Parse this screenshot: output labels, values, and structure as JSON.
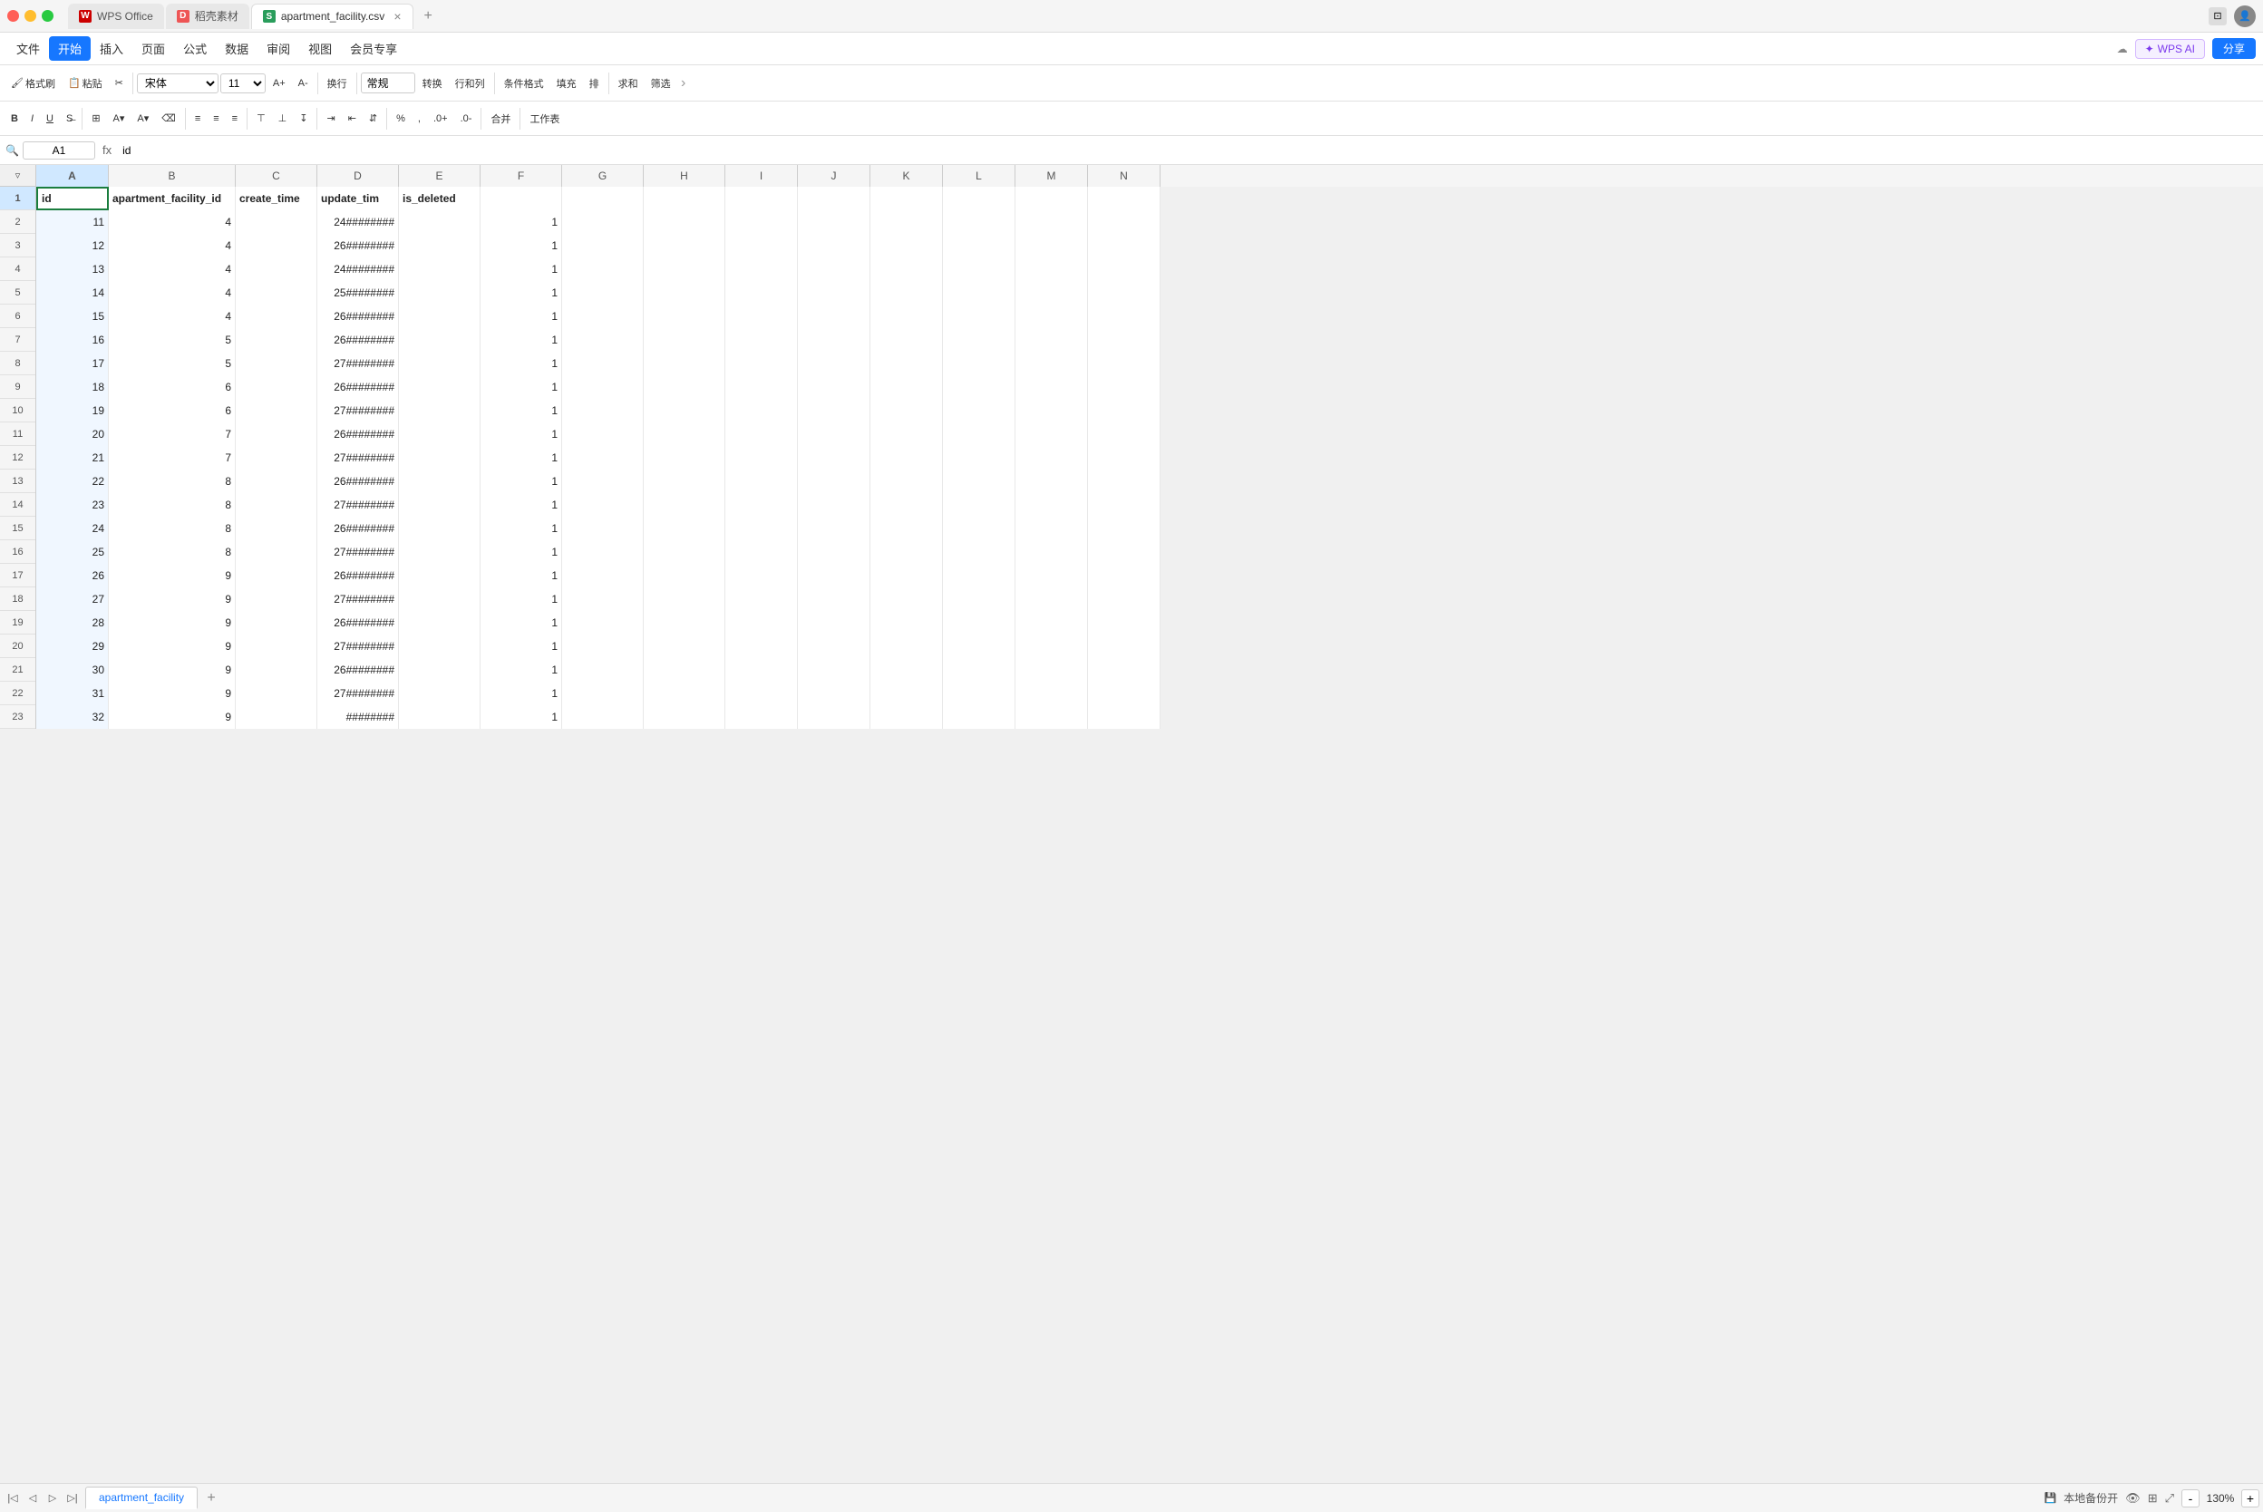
{
  "titleBar": {
    "tabs": [
      {
        "id": "wps-office",
        "label": "WPS Office",
        "iconChar": "W",
        "iconBg": "#c00",
        "active": false
      },
      {
        "id": "daoke",
        "label": "稻壳素材",
        "iconChar": "D",
        "iconBg": "#e55",
        "active": false
      },
      {
        "id": "sheet",
        "label": "apartment_facility.csv",
        "iconChar": "S",
        "iconBg": "#2a9d5c",
        "active": true
      }
    ],
    "newTabLabel": "+",
    "windowTitle": "apartment_facility.csv"
  },
  "menuBar": {
    "items": [
      "文件",
      "开始",
      "插入",
      "页面",
      "公式",
      "数据",
      "审阅",
      "视图",
      "会员专享"
    ],
    "activeItem": "开始",
    "wpsAI": "WPS AI",
    "share": "分享"
  },
  "toolbar1": {
    "formatBrush": "格式刷",
    "paste": "粘贴",
    "cut": "✂",
    "font": "宋体",
    "fontSize": "11",
    "increaseFontSize": "A+",
    "decreaseFontSize": "A-",
    "换行": "换行",
    "numberFormat": "常规",
    "转换": "转换",
    "行和列": "行和列",
    "条件格式": "条件格式",
    "填充": "填充",
    "排": "排",
    "求和": "求和",
    "筛选": "筛选"
  },
  "toolbar2": {
    "bold": "B",
    "italic": "I",
    "underline": "U",
    "percent": "%",
    "mergeCell": "合并",
    "工作表": "工作表",
    "alignLeft": "≡",
    "alignCenter": "≡",
    "alignRight": "≡"
  },
  "formulaBar": {
    "cellRef": "A1",
    "fx": "fx",
    "formula": "id"
  },
  "grid": {
    "columns": [
      {
        "id": "A",
        "label": "A",
        "width": 80
      },
      {
        "id": "B",
        "label": "B",
        "width": 140
      },
      {
        "id": "C",
        "label": "C",
        "width": 90
      },
      {
        "id": "D",
        "label": "D",
        "width": 90
      },
      {
        "id": "E",
        "label": "E",
        "width": 90
      },
      {
        "id": "F",
        "label": "F",
        "width": 90
      },
      {
        "id": "G",
        "label": "G",
        "width": 90
      },
      {
        "id": "H",
        "label": "H",
        "width": 90
      },
      {
        "id": "I",
        "label": "I",
        "width": 80
      },
      {
        "id": "J",
        "label": "J",
        "width": 80
      },
      {
        "id": "K",
        "label": "K",
        "width": 80
      },
      {
        "id": "L",
        "label": "L",
        "width": 80
      },
      {
        "id": "M",
        "label": "M",
        "width": 80
      },
      {
        "id": "N",
        "label": "N",
        "width": 80
      }
    ],
    "rows": [
      {
        "num": 1,
        "cells": [
          "id",
          "apartment_facility_id",
          "create_time",
          "update_tim",
          "is_deleted",
          "",
          "",
          "",
          "",
          "",
          "",
          "",
          "",
          ""
        ]
      },
      {
        "num": 2,
        "cells": [
          "11",
          "4",
          "",
          "24########",
          "",
          "1",
          "",
          "",
          "",
          "",
          "",
          "",
          "",
          ""
        ]
      },
      {
        "num": 3,
        "cells": [
          "12",
          "4",
          "",
          "26########",
          "",
          "1",
          "",
          "",
          "",
          "",
          "",
          "",
          "",
          ""
        ]
      },
      {
        "num": 4,
        "cells": [
          "13",
          "4",
          "",
          "24########",
          "",
          "1",
          "",
          "",
          "",
          "",
          "",
          "",
          "",
          ""
        ]
      },
      {
        "num": 5,
        "cells": [
          "14",
          "4",
          "",
          "25########",
          "",
          "1",
          "",
          "",
          "",
          "",
          "",
          "",
          "",
          ""
        ]
      },
      {
        "num": 6,
        "cells": [
          "15",
          "4",
          "",
          "26########",
          "",
          "1",
          "",
          "",
          "",
          "",
          "",
          "",
          "",
          ""
        ]
      },
      {
        "num": 7,
        "cells": [
          "16",
          "5",
          "",
          "26########",
          "",
          "1",
          "",
          "",
          "",
          "",
          "",
          "",
          "",
          ""
        ]
      },
      {
        "num": 8,
        "cells": [
          "17",
          "5",
          "",
          "27########",
          "",
          "1",
          "",
          "",
          "",
          "",
          "",
          "",
          "",
          ""
        ]
      },
      {
        "num": 9,
        "cells": [
          "18",
          "6",
          "",
          "26########",
          "",
          "1",
          "",
          "",
          "",
          "",
          "",
          "",
          "",
          ""
        ]
      },
      {
        "num": 10,
        "cells": [
          "19",
          "6",
          "",
          "27########",
          "",
          "1",
          "",
          "",
          "",
          "",
          "",
          "",
          "",
          ""
        ]
      },
      {
        "num": 11,
        "cells": [
          "20",
          "7",
          "",
          "26########",
          "",
          "1",
          "",
          "",
          "",
          "",
          "",
          "",
          "",
          ""
        ]
      },
      {
        "num": 12,
        "cells": [
          "21",
          "7",
          "",
          "27########",
          "",
          "1",
          "",
          "",
          "",
          "",
          "",
          "",
          "",
          ""
        ]
      },
      {
        "num": 13,
        "cells": [
          "22",
          "8",
          "",
          "26########",
          "",
          "1",
          "",
          "",
          "",
          "",
          "",
          "",
          "",
          ""
        ]
      },
      {
        "num": 14,
        "cells": [
          "23",
          "8",
          "",
          "27########",
          "",
          "1",
          "",
          "",
          "",
          "",
          "",
          "",
          "",
          ""
        ]
      },
      {
        "num": 15,
        "cells": [
          "24",
          "8",
          "",
          "26########",
          "",
          "1",
          "",
          "",
          "",
          "",
          "",
          "",
          "",
          ""
        ]
      },
      {
        "num": 16,
        "cells": [
          "25",
          "8",
          "",
          "27########",
          "",
          "1",
          "",
          "",
          "",
          "",
          "",
          "",
          "",
          ""
        ]
      },
      {
        "num": 17,
        "cells": [
          "26",
          "9",
          "",
          "26########",
          "",
          "1",
          "",
          "",
          "",
          "",
          "",
          "",
          "",
          ""
        ]
      },
      {
        "num": 18,
        "cells": [
          "27",
          "9",
          "",
          "27########",
          "",
          "1",
          "",
          "",
          "",
          "",
          "",
          "",
          "",
          ""
        ]
      },
      {
        "num": 19,
        "cells": [
          "28",
          "9",
          "",
          "26########",
          "",
          "1",
          "",
          "",
          "",
          "",
          "",
          "",
          "",
          ""
        ]
      },
      {
        "num": 20,
        "cells": [
          "29",
          "9",
          "",
          "27########",
          "",
          "1",
          "",
          "",
          "",
          "",
          "",
          "",
          "",
          ""
        ]
      },
      {
        "num": 21,
        "cells": [
          "30",
          "9",
          "",
          "26########",
          "",
          "1",
          "",
          "",
          "",
          "",
          "",
          "",
          "",
          ""
        ]
      },
      {
        "num": 22,
        "cells": [
          "31",
          "9",
          "",
          "27########",
          "",
          "1",
          "",
          "",
          "",
          "",
          "",
          "",
          "",
          ""
        ]
      },
      {
        "num": 23,
        "cells": [
          "32",
          "9",
          "",
          "########",
          "",
          "1",
          "",
          "",
          "",
          "",
          "",
          "",
          "",
          ""
        ]
      }
    ]
  },
  "bottomBar": {
    "navBtns": [
      "|<",
      "<",
      ">",
      ">|"
    ],
    "sheetName": "apartment_facility",
    "addSheet": "+",
    "statusText": "本地备份开",
    "zoomLevel": "130%",
    "zoomIn": "+",
    "zoomOut": "-"
  }
}
